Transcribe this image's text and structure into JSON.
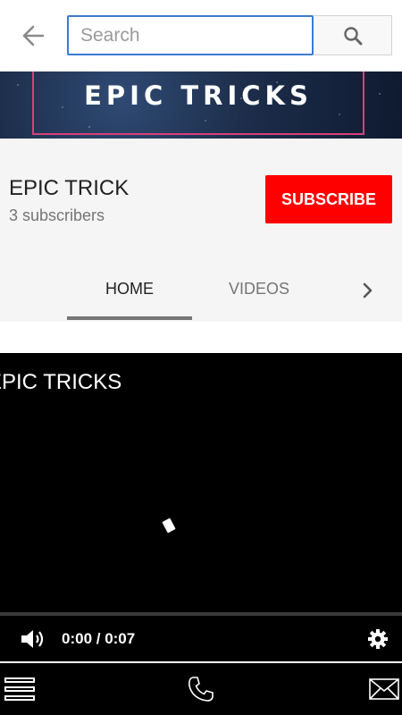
{
  "search": {
    "placeholder": "Search",
    "value": ""
  },
  "banner": {
    "title": "EPIC TRICKS"
  },
  "channel": {
    "name": "EPIC TRICK",
    "subscribers": "3 subscribers",
    "subscribe_label": "SUBSCRIBE"
  },
  "tabs": [
    {
      "label": "HOME",
      "active": true
    },
    {
      "label": "VIDEOS",
      "active": false
    }
  ],
  "player": {
    "title": "EPIC TRICKS",
    "time": "0:00 / 0:07",
    "progress": 0
  },
  "icons": {
    "back": "arrow-left-icon",
    "search": "magnifier-icon",
    "next": "chevron-right-icon",
    "volume": "speaker-icon",
    "settings": "gear-icon",
    "menu": "hamburger-icon",
    "phone": "phone-icon",
    "mail": "envelope-icon"
  },
  "colors": {
    "accent": "#3b7bd4",
    "subscribe": "#ff0000",
    "banner_border": "#d6407a"
  }
}
